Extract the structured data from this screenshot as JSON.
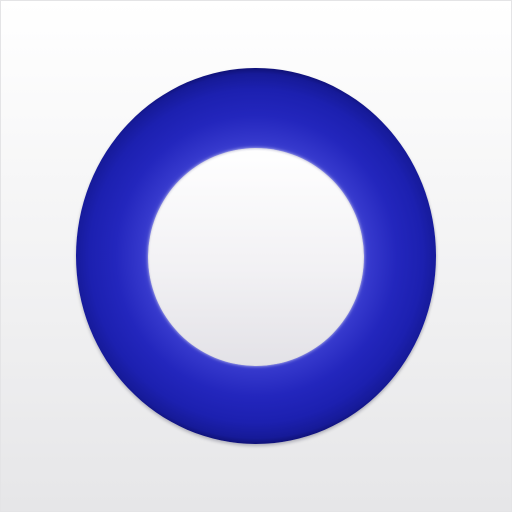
{
  "icon": {
    "name": "circle-ring-icon",
    "colors": {
      "ring_dark": "#161a98",
      "ring_mid": "#2326bd",
      "ring_light": "#8f91ec",
      "hole": "#f2f1f4",
      "background": "#f1f1f2"
    }
  }
}
